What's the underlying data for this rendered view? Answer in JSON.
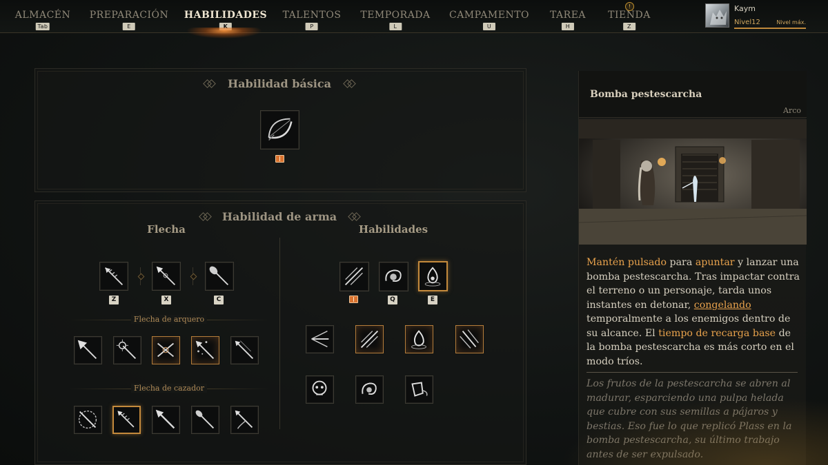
{
  "nav": {
    "tabs": [
      {
        "label": "ALMACÉN",
        "key": "Tab"
      },
      {
        "label": "PREPARACIÓN",
        "key": "E"
      },
      {
        "label": "HABILIDADES",
        "key": "K"
      },
      {
        "label": "TALENTOS",
        "key": "P"
      },
      {
        "label": "TEMPORADA",
        "key": "L"
      },
      {
        "label": "CAMPAMENTO",
        "key": "U"
      },
      {
        "label": "TAREA",
        "key": "H"
      },
      {
        "label": "TIENDA",
        "key": "Z"
      }
    ],
    "active_tab": "HABILIDADES",
    "alert": "!"
  },
  "profile": {
    "name": "Kaym",
    "level": "Nivel12",
    "max": "Nivel máx."
  },
  "basic": {
    "title": "Habilidad básica"
  },
  "weapon": {
    "title": "Habilidad de arma",
    "arrows": {
      "title": "Flecha",
      "keys": [
        "Z",
        "X",
        "C"
      ],
      "archer_title": "Flecha de arquero",
      "hunter_title": "Flecha de cazador"
    },
    "skills": {
      "title": "Habilidades",
      "keys": [
        "Q",
        "E"
      ]
    }
  },
  "detail": {
    "name": "Bomba pestescarcha",
    "weapon": "Arco",
    "desc": {
      "p1": "Mantén pulsado",
      "p2": " para ",
      "p3": "apuntar",
      "p4": " y lanzar una bomba pestescarcha. Tras impactar contra el terreno o un personaje, tarda unos instantes en detonar, ",
      "p5": "congelando",
      "p6": " temporalmente a los enemigos dentro de su alcance. El ",
      "p7": "tiempo de recarga base",
      "p8": " de la bomba pestescarcha es más corto en el modo tríos."
    },
    "lore": "Los frutos de la pestescarcha se abren al madurar, esparciendo una pulpa helada que cubre con sus semillas a pájaros y bestias. Eso fue lo que replicó Plass en la bomba pestescarcha, su último trabajo antes de ser expulsado."
  },
  "colors": {
    "accent": "#e8a24c",
    "selected_border": "#c48a3c",
    "background": "#121513"
  }
}
